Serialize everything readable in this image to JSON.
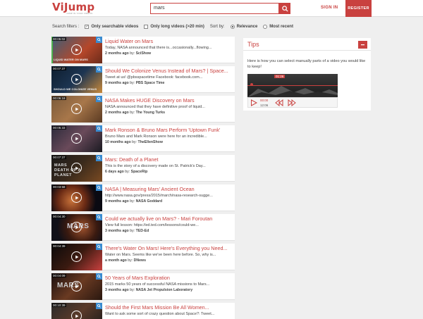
{
  "header": {
    "logo_main": "ViJump",
    "logo_sub": "JUMP IN YOUR VIDEOS",
    "search_value": "mars",
    "signin_label": "SIGN IN",
    "register_label": "REGISTER",
    "accent_color": "#c9413f"
  },
  "filters": {
    "label": "Search filters :",
    "opt1": "Only searchable videos",
    "opt1_checked": true,
    "opt2": "Only long videos (>20 min)",
    "opt2_checked": false,
    "sort_label": "Sort by:",
    "sort1": "Relevance",
    "sort2": "Most recent",
    "sort_selected": "Relevance"
  },
  "results": [
    {
      "duration": "00:05:02",
      "title": "Liquid Water on Mars",
      "desc": "Today, NASA announced that there is...occasionally...flowing...",
      "age": "2 months ago",
      "by": "by:",
      "channel": "SciShow",
      "thumb_caption": "LIQUID WATER ON MARS"
    },
    {
      "duration": "00:07:37",
      "title": "Should We Colonize Venus Instead of Mars? | Space...",
      "desc": "Tweet at us! @pbsspacetime Facebook: facebook.com...",
      "age": "9 months ago",
      "by": "by:",
      "channel": "PBS Space Time",
      "thumb_caption": "SHOULD WE COLONIZE VENUS"
    },
    {
      "duration": "00:06:18",
      "title": "NASA Makes HUGE Discovery on Mars",
      "desc": "NASA announced that they have definitive proof of liquid...",
      "age": "2 months ago",
      "by": "by:",
      "channel": "The Young Turks",
      "thumb_caption": ""
    },
    {
      "duration": "00:05:33",
      "title": "Mark Ronson & Bruno Mars Perform 'Uptown Funk'",
      "desc": "Bruno Mars and Mark Ronson were here for an incredible...",
      "age": "10 months ago",
      "by": "by:",
      "channel": "TheEllenShow",
      "thumb_caption": ""
    },
    {
      "duration": "00:07:37",
      "title": "Mars: Death of a Planet",
      "desc": "This is the story of a discovery made on St. Patrick's Day...",
      "age": "6 days ago",
      "by": "by:",
      "channel": "SpaceRip",
      "thumb_caption": "MARS DEATH OF A PLANET"
    },
    {
      "duration": "00:03:58",
      "title": "NASA | Measuring Mars' Ancient Ocean",
      "desc": "http://www.nasa.gov/press/2015/march/nasa-research-sugge...",
      "age": "9 months ago",
      "by": "by:",
      "channel": "NASA Goddard",
      "thumb_caption": ""
    },
    {
      "duration": "00:04:30",
      "title": "Could we actually live on Mars? - Mari Foroutan",
      "desc": "View full lesson: https://ed.ted.com/lessons/could-we...",
      "age": "3 months ago",
      "by": "by:",
      "channel": "TED-Ed",
      "thumb_caption": "MARS"
    },
    {
      "duration": "00:04:39",
      "title": "There's Water On Mars! Here's Everything you Need...",
      "desc": "Water on Mars. Seems like we've been here before. So, why is...",
      "age": "a month ago",
      "by": "by:",
      "channel": "DNews",
      "thumb_caption": ""
    },
    {
      "duration": "00:04:09",
      "title": "50 Years of Mars Exploration",
      "desc": "2015 marks 50 years of successful NASA missions to Mars...",
      "age": "3 months ago",
      "by": "by:",
      "channel": "NASA Jet Propulsion Laboratory",
      "thumb_caption": "MARS"
    },
    {
      "duration": "00:10:39",
      "title": "Should the First Mars Mission Be All Women...",
      "desc": "Want to ask some sort of crazy question about Space?: Tweet...",
      "age": "",
      "by": "",
      "channel": "",
      "thumb_caption": ""
    }
  ],
  "tips": {
    "title": "Tips",
    "text": "Here is how you can select manually parts of a video you would like to keep!",
    "player_marker": "01:26",
    "time_current": "00:00",
    "time_total": "12:06"
  },
  "icons": {
    "search": "search-icon",
    "close": "minus-icon",
    "play": "play-icon",
    "add": "search-icon",
    "prev": "rewind-icon",
    "next": "forward-icon"
  }
}
